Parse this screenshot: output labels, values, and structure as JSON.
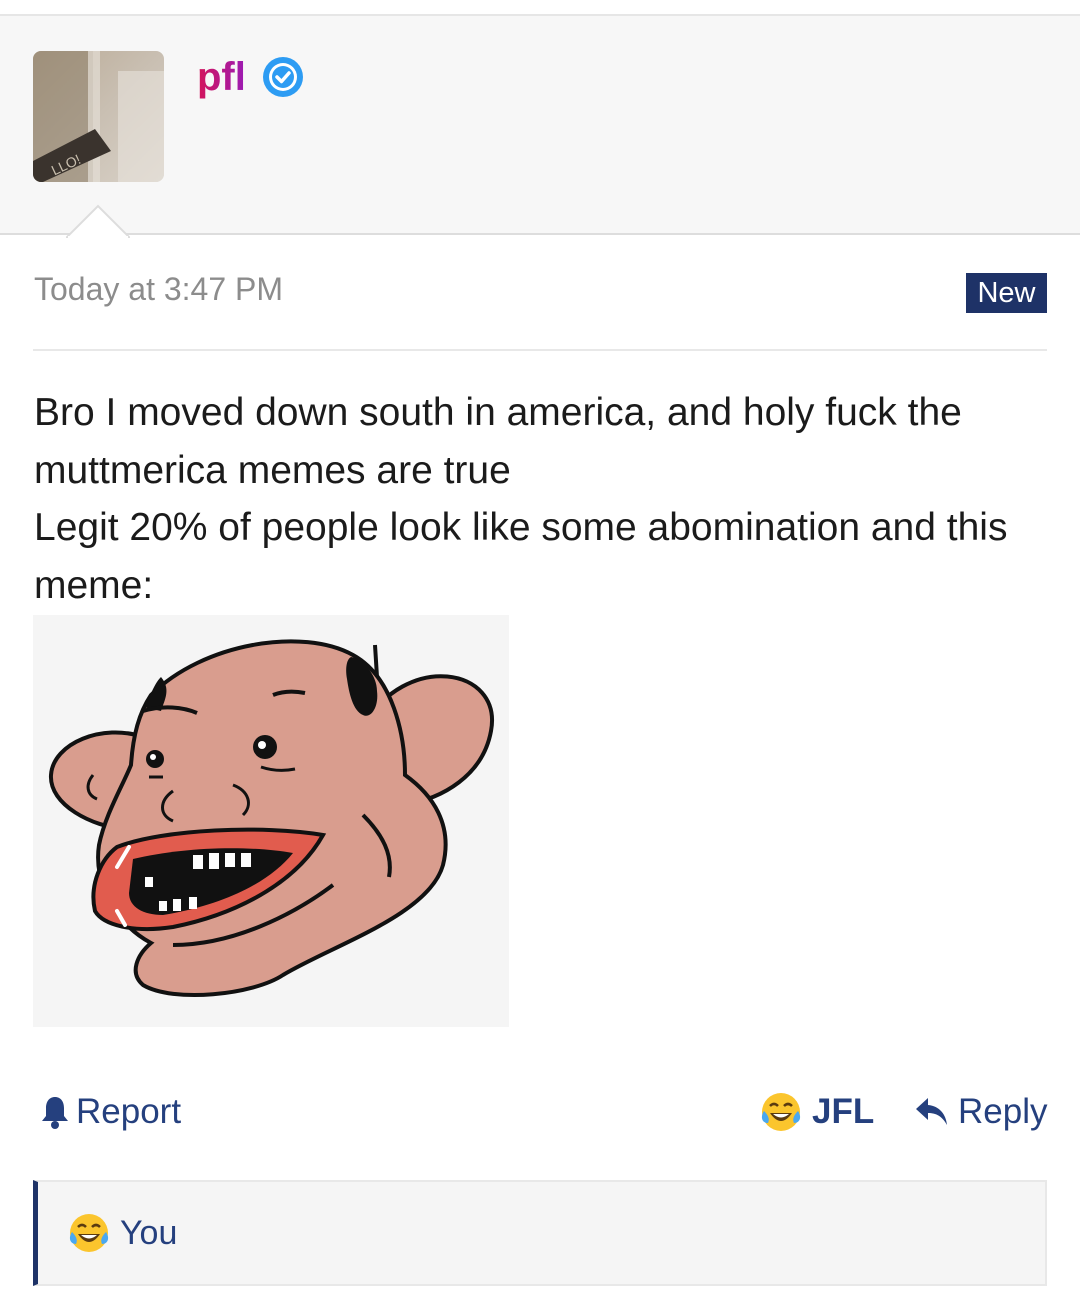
{
  "author": {
    "username": "pfl",
    "avatar_icon": "avatar-photo",
    "verified_icon": "verified-check-icon",
    "username_gradient": [
      "#d4145a",
      "#9b1bb5"
    ]
  },
  "post": {
    "timestamp": "Today at 3:47 PM",
    "badge": "New",
    "paragraphs": [
      "Bro I moved down south in america, and holy fuck the muttmerica memes are true",
      "Legit 20% of people look like some abomination and this meme:"
    ],
    "image_icon": "mutt-face-meme"
  },
  "actions": {
    "report": "Report",
    "reaction": "JFL",
    "reply": "Reply",
    "report_icon": "bell-icon",
    "reaction_icon": "laughing-crying-emoji",
    "reply_icon": "reply-arrow-icon"
  },
  "reactions": {
    "who": "You",
    "icon": "laughing-crying-emoji"
  },
  "colors": {
    "accent": "#25407e",
    "badge_bg": "#1e3267",
    "verified": "#2d9cf3"
  }
}
